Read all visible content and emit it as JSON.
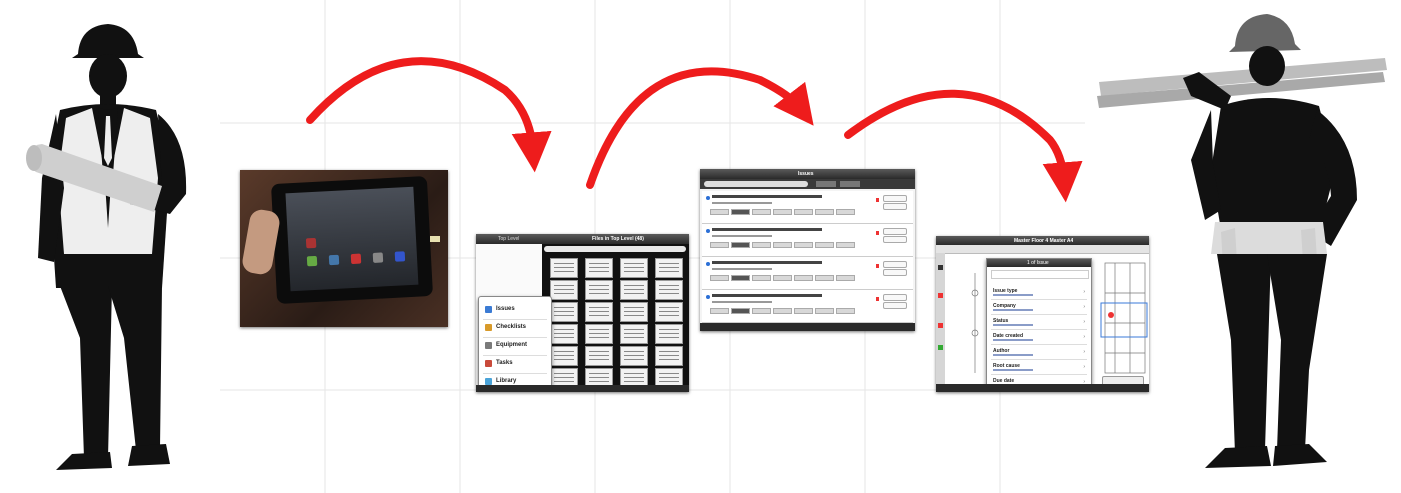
{
  "screens": {
    "library": {
      "header_left": "Top Level",
      "header_center": "Files in Top Level (48)",
      "menu": [
        {
          "label": "Issues",
          "icon": "issues-icon",
          "color": "#3b7bd4"
        },
        {
          "label": "Checklists",
          "icon": "checklist-icon",
          "color": "#d89a2a"
        },
        {
          "label": "Equipment",
          "icon": "equipment-icon",
          "color": "#7a7a7a"
        },
        {
          "label": "Tasks",
          "icon": "tasks-icon",
          "color": "#c94a3a"
        },
        {
          "label": "Library",
          "icon": "library-icon",
          "color": "#4aa3d8"
        }
      ]
    },
    "issues": {
      "header_center": "Issues"
    },
    "sheet": {
      "header_center": "Master Floor 4 Master A4",
      "popup_header": "1 of Issue",
      "fields": [
        {
          "label": "Issue type"
        },
        {
          "label": "Company"
        },
        {
          "label": "Status"
        },
        {
          "label": "Date created"
        },
        {
          "label": "Author"
        },
        {
          "label": "Root cause"
        },
        {
          "label": "Due date"
        }
      ]
    }
  },
  "colors": {
    "arrow": "#ee1c1c",
    "silhouette": "#111111",
    "vest": "#eeeeee",
    "blueprint": "#cfcfcf"
  }
}
